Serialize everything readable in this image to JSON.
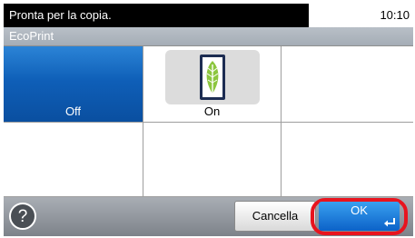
{
  "status_bar": {
    "message": "Pronta per la copia.",
    "time": "10:10"
  },
  "title_bar": {
    "title": "EcoPrint"
  },
  "options": [
    {
      "label": "Off",
      "selected": true
    },
    {
      "label": "On",
      "selected": false,
      "icon": "eco-leaf-icon"
    }
  ],
  "footer": {
    "help_icon": "?",
    "cancel_label": "Cancella",
    "ok_label": "OK"
  },
  "colors": {
    "selected": "#0f5fb8",
    "highlight": "#e8141e",
    "ok": "#1a7ad8"
  }
}
